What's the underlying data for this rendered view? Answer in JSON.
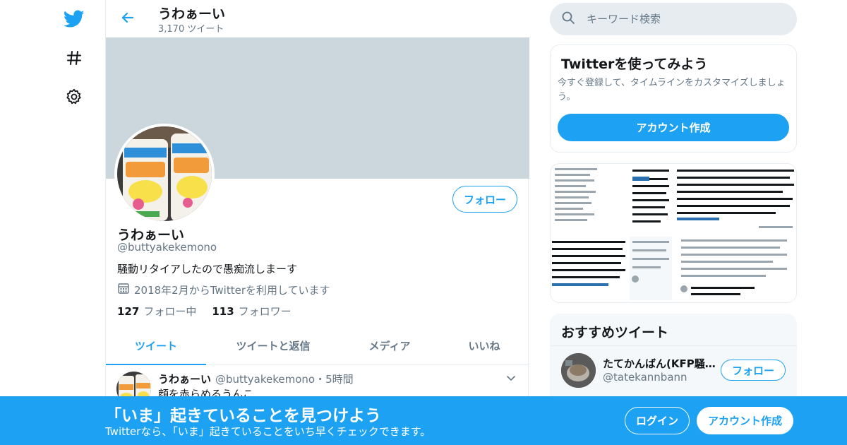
{
  "nav": {
    "items": [
      {
        "icon": "twitter-bird-icon"
      },
      {
        "icon": "hashtag-icon"
      },
      {
        "icon": "gear-icon"
      }
    ]
  },
  "header": {
    "name": "うわぁーい",
    "tweet_count": "3,170 ツイート"
  },
  "profile": {
    "name": "うわぁーい",
    "handle": "@buttyakekemono",
    "bio": "騒動リタイアしたので愚痴流しまーす",
    "joined": "2018年2月からTwitterを利用しています",
    "following_count": "127",
    "following_label": "フォロー中",
    "followers_count": "113",
    "followers_label": "フォロワー",
    "follow_label": "フォロー"
  },
  "tabs": [
    {
      "label": "ツイート",
      "active": true
    },
    {
      "label": "ツイートと返信",
      "active": false
    },
    {
      "label": "メディア",
      "active": false
    },
    {
      "label": "いいね",
      "active": false
    }
  ],
  "tweet": {
    "name": "うわぁーい",
    "meta": "@buttyakekemono・5時間",
    "text": "顔を赤らめるうんこ"
  },
  "search": {
    "placeholder": "キーワード検索"
  },
  "signup_card": {
    "title": "Twitterを使ってみよう",
    "desc": "今すぐ登録して、タイムラインをカスタマイズしましょう。",
    "button": "アカウント作成"
  },
  "recommended": {
    "title": "おすすめツイート",
    "name": "たてかんばん(KFP騒動…",
    "handle": "@tatekannbann",
    "follow_label": "フォロー"
  },
  "bottom_bar": {
    "title": "「いま」起きていることを見つけよう",
    "subtitle": "Twitterなら、「いま」起きていることをいち早くチェックできます。",
    "login": "ログイン",
    "signup": "アカウント作成"
  },
  "colors": {
    "accent": "#1da1f2",
    "banner": "#ccd6dd",
    "secondary_text": "#657786"
  }
}
